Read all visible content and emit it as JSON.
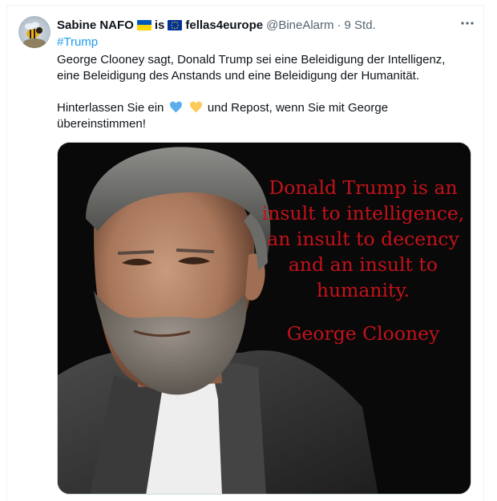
{
  "tweet": {
    "author_name": "Sabine NAFO",
    "connector": "is",
    "author_name_2": "fellas4europe",
    "handle": "@BineAlarm",
    "separator": "·",
    "time": "9 Std.",
    "more_icon": "ellipsis-icon",
    "hashtag": "#Trump",
    "text_line_1": "George Clooney sagt, Donald Trump sei eine Beleidigung der Intelligenz,",
    "text_line_2": "eine Beleidigung des Anstands und eine Beleidigung der Humanität.",
    "text_line_3a": "Hinterlassen Sie ein",
    "text_line_3b": "und Repost, wenn Sie mit George",
    "text_line_4": "übereinstimmen!",
    "emojis": [
      "blue-heart-icon",
      "yellow-heart-icon"
    ]
  },
  "media": {
    "quote_lines": [
      "Donald Trump is an",
      "insult to intelligence,",
      "an insult to decency",
      "and an insult to",
      "humanity."
    ],
    "author": "George Clooney",
    "quote_color": "#c4121a"
  },
  "colors": {
    "link": "#1d9bf0",
    "muted": "#536471",
    "text": "#0f1419"
  }
}
